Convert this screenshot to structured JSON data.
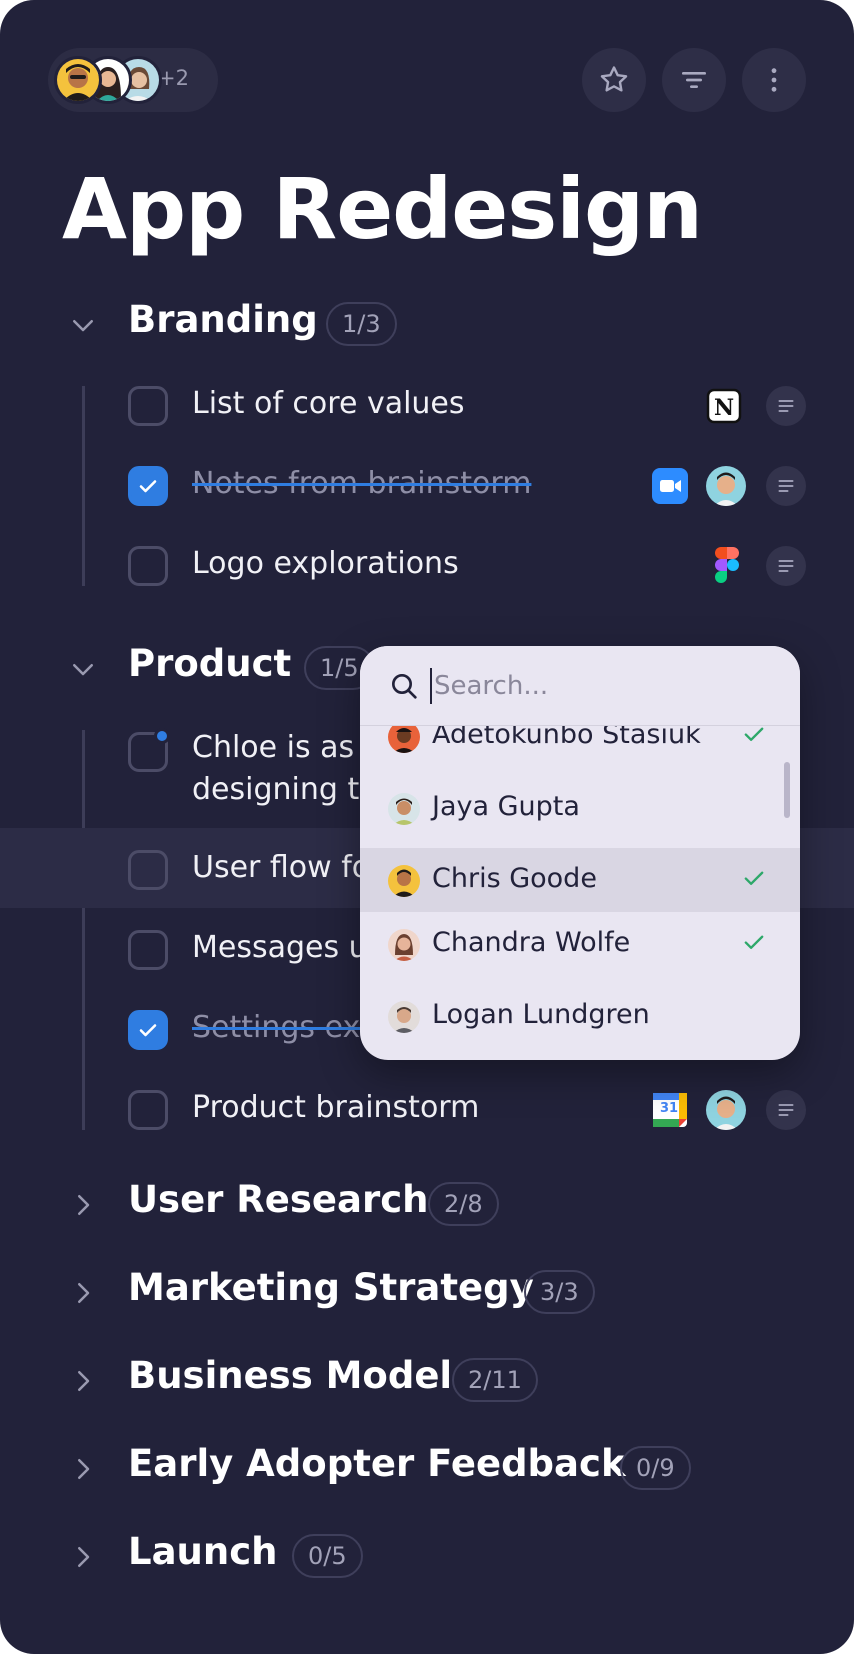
{
  "header": {
    "extra_collaborators": "+2",
    "collaborators": [
      {
        "name": "collaborator-1",
        "bg": "#f4c23d",
        "skin": "#b87447",
        "hair": "#1f1b1b"
      },
      {
        "name": "collaborator-2",
        "bg": "#ffffff",
        "skin": "#e8b894",
        "hair": "#2a2020"
      },
      {
        "name": "collaborator-3",
        "bg": "#b8dbe6",
        "skin": "#e6c1a2",
        "hair": "#6a4a36"
      }
    ],
    "buttons": [
      "star-icon",
      "filter-icon",
      "more-vertical-icon"
    ]
  },
  "page": {
    "title": "App Redesign"
  },
  "sections": [
    {
      "name": "Branding",
      "count": "1/3",
      "expanded": true,
      "tasks": [
        {
          "label": "List of core values",
          "done": false,
          "apps": [
            "notion-icon"
          ]
        },
        {
          "label": "Notes from brainstorm",
          "done": true,
          "apps": [
            "zoom-icon",
            "assignee-avatar"
          ]
        },
        {
          "label": "Logo explorations",
          "done": false,
          "apps": [
            "figma-icon"
          ]
        }
      ]
    },
    {
      "name": "Product",
      "count": "1/5",
      "expanded": true,
      "tasks": [
        {
          "label_line1": "Chloe is as",
          "label_line2": "designing t",
          "done": false,
          "notified": true
        },
        {
          "label": "User flow fo",
          "done": false,
          "highlighted": true
        },
        {
          "label": "Messages u",
          "done": false
        },
        {
          "label": "Settings ex",
          "done": true
        },
        {
          "label": "Product brainstorm",
          "done": false,
          "apps": [
            "google-calendar-icon",
            "assignee-avatar"
          ],
          "calendar_day": "31"
        }
      ]
    },
    {
      "name": "User Research",
      "count": "2/8",
      "expanded": false
    },
    {
      "name": "Marketing Strategy",
      "count": "3/3",
      "expanded": false
    },
    {
      "name": "Business Model",
      "count": "2/11",
      "expanded": false
    },
    {
      "name": "Early Adopter Feedback",
      "count": "0/9",
      "expanded": false
    },
    {
      "name": "Launch",
      "count": "0/5",
      "expanded": false
    }
  ],
  "assignee_dropdown": {
    "search_placeholder": "Search...",
    "options": [
      {
        "name": "Adetokunbo Stasiuk",
        "checked": true
      },
      {
        "name": "Jaya Gupta",
        "checked": false
      },
      {
        "name": "Chris Goode",
        "checked": true,
        "hovered": true
      },
      {
        "name": "Chandra Wolfe",
        "checked": true
      },
      {
        "name": "Logan Lundgren",
        "checked": false
      }
    ]
  },
  "colors": {
    "background": "#22223a",
    "accent_blue": "#2f7de1",
    "check_green": "#2ea86a",
    "dropdown_bg": "#e9e6f2"
  }
}
